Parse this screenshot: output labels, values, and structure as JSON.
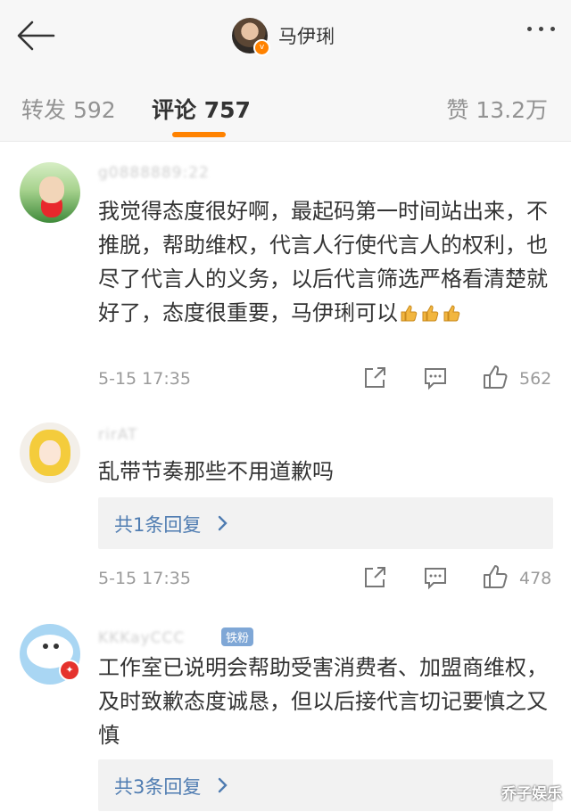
{
  "header": {
    "back_icon": "arrow-left-icon",
    "profile_name": "马伊琍",
    "verified_badge": "v",
    "more_icon": "more-dots-icon"
  },
  "tabs": {
    "repost": "转发 592",
    "comment": "评论 757",
    "like": "赞 13.2万",
    "active_color": "#ff8200"
  },
  "comments": [
    {
      "user": "g0888889:22",
      "text": "我觉得态度很好啊，最起码第一时间站出来，不推脱，帮助维权，代言人行使代言人的权利，也尽了代言人的义务，以后代言筛选严格看清楚就好了，态度很重要，马伊琍可以",
      "emoji": "👍👍👍",
      "time": "5-15 17:35",
      "likes": "562"
    },
    {
      "user": "rirAT",
      "text": "乱带节奏那些不用道歉吗",
      "reply_summary": "共1条回复",
      "time": "5-15 17:35",
      "likes": "478"
    },
    {
      "user": "KKKayCCC",
      "fan_badge": "铁粉",
      "text": "工作室已说明会帮助受害消费者、加盟商维权，及时致歉态度诚恳，但以后接代言切记要慎之又慎",
      "reply_summary": "共3条回复"
    }
  ],
  "colors": {
    "link_blue": "#4f7cb1",
    "meta_gray": "#9b9b9b",
    "fan_badge": "#7fa7d6"
  },
  "watermark": "乔子娱乐"
}
